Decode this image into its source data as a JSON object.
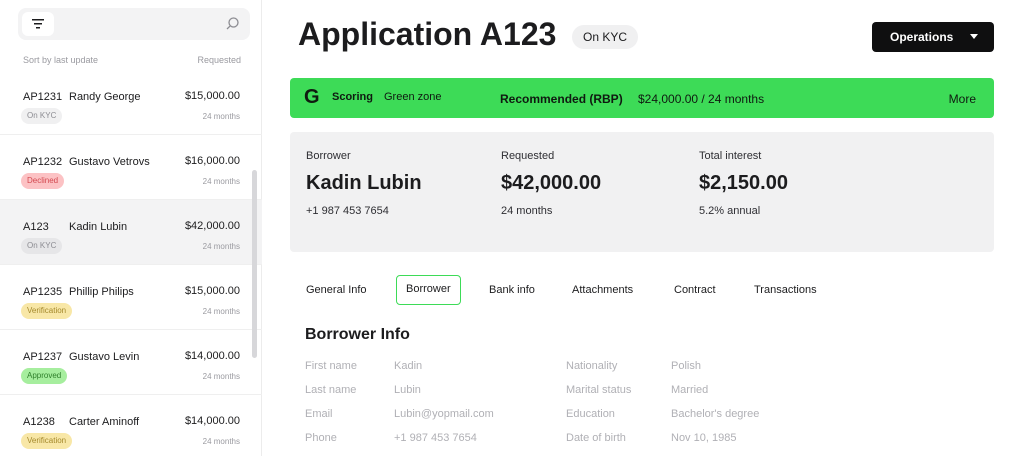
{
  "sidebar": {
    "sort_label": "Sort by last update",
    "requested_label": "Requested",
    "items": [
      {
        "code": "AP1231",
        "name": "Randy George",
        "amount": "$15,000.00",
        "term": "24 months",
        "status": "On KYC",
        "status_color": "gray"
      },
      {
        "code": "AP1232",
        "name": "Gustavo Vetrovs",
        "amount": "$16,000.00",
        "term": "24 months",
        "status": "Declined",
        "status_color": "red"
      },
      {
        "code": "A123",
        "name": "Kadin Lubin",
        "amount": "$42,000.00",
        "term": "24 months",
        "status": "On KYC",
        "status_color": "gray"
      },
      {
        "code": "AP1235",
        "name": "Phillip Philips",
        "amount": "$15,000.00",
        "term": "24 months",
        "status": "Verification",
        "status_color": "yellow"
      },
      {
        "code": "AP1237",
        "name": "Gustavo Levin",
        "amount": "$14,000.00",
        "term": "24 months",
        "status": "Approved",
        "status_color": "green"
      },
      {
        "code": "A1238",
        "name": "Carter Aminoff",
        "amount": "$14,000.00",
        "term": "24 months",
        "status": "Verification",
        "status_color": "yellow"
      }
    ]
  },
  "header": {
    "title": "Application A123",
    "status": "On KYC",
    "operations_label": "Operations"
  },
  "scoring": {
    "logo": "G",
    "label": "Scoring",
    "zone": "Green zone",
    "recommended_label": "Recommended (RBP)",
    "recommended_value": "$24,000.00 / 24 months",
    "more_label": "More",
    "color": "#3ddb57"
  },
  "summary": {
    "borrower": {
      "label": "Borrower",
      "value": "Kadin Lubin",
      "sub": "+1 987 453 7654"
    },
    "requested": {
      "label": "Requested",
      "value": "$42,000.00",
      "sub": "24 months"
    },
    "interest": {
      "label": "Total interest",
      "value": "$2,150.00",
      "sub": "5.2% annual"
    }
  },
  "tabs": [
    "General Info",
    "Borrower",
    "Bank info",
    "Attachments",
    "Contract",
    "Transactions"
  ],
  "active_tab": "Borrower",
  "borrower_info": {
    "title": "Borrower Info",
    "left": [
      {
        "label": "First name",
        "value": "Kadin"
      },
      {
        "label": "Last name",
        "value": "Lubin"
      },
      {
        "label": "Email",
        "value": "Lubin@yopmail.com"
      },
      {
        "label": "Phone",
        "value": "+1 987 453 7654"
      }
    ],
    "right": [
      {
        "label": "Nationality",
        "value": "Polish"
      },
      {
        "label": "Marital status",
        "value": "Married"
      },
      {
        "label": "Education",
        "value": "Bachelor's degree"
      },
      {
        "label": "Date of birth",
        "value": "Nov 10, 1985"
      }
    ]
  }
}
